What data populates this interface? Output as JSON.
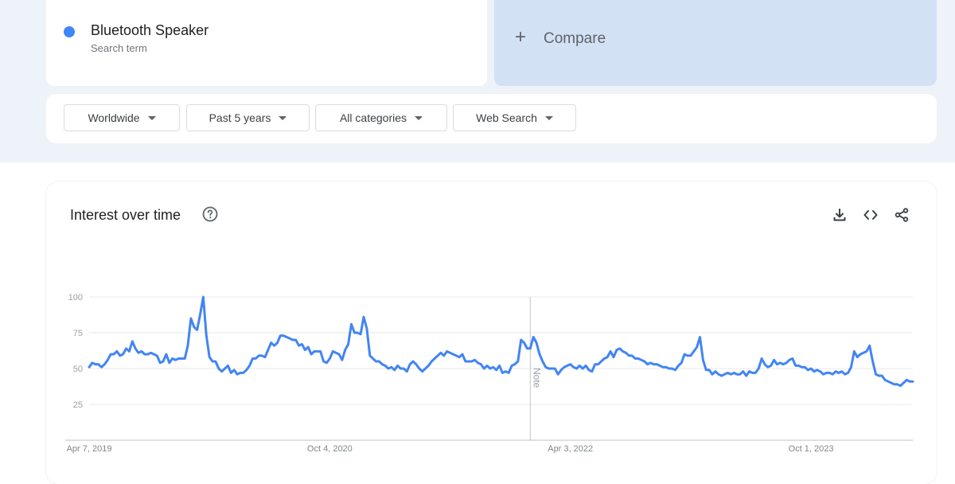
{
  "search_term": {
    "name": "Bluetooth Speaker",
    "subtitle": "Search term",
    "color": "#4285f4"
  },
  "compare": {
    "label": "Compare"
  },
  "filters": [
    {
      "label": "Worldwide"
    },
    {
      "label": "Past 5 years"
    },
    {
      "label": "All categories"
    },
    {
      "label": "Web Search"
    }
  ],
  "chart_panel": {
    "title": "Interest over time",
    "note_label": "Note"
  },
  "chart_data": {
    "type": "line",
    "title": "Interest over time",
    "ylim": [
      0,
      100
    ],
    "yticks": [
      25,
      50,
      75,
      100
    ],
    "grid": true,
    "x_tick_labels": [
      "Apr 7, 2019",
      "Oct 4, 2020",
      "Apr 3, 2022",
      "Oct 1, 2023"
    ],
    "x_tick_index": [
      0,
      78,
      156,
      234
    ],
    "note_index": 143,
    "series": [
      {
        "color": "#4285f4",
        "values": [
          51,
          54,
          53,
          53,
          51,
          53,
          56,
          60,
          60,
          62,
          59,
          60,
          64,
          62,
          69,
          64,
          61,
          62,
          60,
          60,
          61,
          60,
          59,
          54,
          55,
          60,
          54,
          57,
          56,
          57,
          57,
          57,
          66,
          85,
          79,
          77,
          88,
          100,
          73,
          58,
          55,
          55,
          50,
          48,
          50,
          52,
          47,
          49,
          46,
          47,
          47,
          49,
          52,
          57,
          57,
          59,
          59,
          58,
          63,
          68,
          66,
          68,
          73,
          73,
          72,
          71,
          70,
          70,
          66,
          67,
          63,
          65,
          60,
          62,
          62,
          62,
          55,
          54,
          57,
          62,
          61,
          60,
          56,
          63,
          67,
          81,
          75,
          75,
          74,
          86,
          78,
          59,
          57,
          55,
          55,
          53,
          52,
          50,
          51,
          49,
          52,
          50,
          50,
          48,
          53,
          55,
          53,
          50,
          48,
          50,
          52,
          55,
          57,
          59,
          61,
          59,
          62,
          61,
          60,
          59,
          58,
          60,
          55,
          55,
          55,
          56,
          54,
          53,
          50,
          52,
          50,
          51,
          49,
          52,
          47,
          48,
          47,
          52,
          53,
          55,
          70,
          68,
          64,
          64,
          72,
          68,
          60,
          55,
          51,
          50,
          50,
          50,
          46,
          49,
          51,
          52,
          53,
          51,
          50,
          52,
          50,
          52,
          49,
          48,
          53,
          53,
          55,
          57,
          58,
          62,
          58,
          63,
          64,
          62,
          61,
          59,
          59,
          57,
          57,
          56,
          55,
          53,
          54,
          53,
          53,
          52,
          51,
          51,
          50,
          50,
          49,
          52,
          54,
          60,
          59,
          59,
          62,
          65,
          72,
          56,
          49,
          49,
          46,
          48,
          46,
          45,
          46,
          47,
          46,
          47,
          46,
          46,
          48,
          45,
          48,
          47,
          47,
          50,
          57,
          53,
          51,
          52,
          56,
          53,
          54,
          53,
          54,
          56,
          57,
          52,
          52,
          51,
          51,
          49,
          50,
          48,
          49,
          48,
          46,
          47,
          47,
          46,
          48,
          47,
          48,
          46,
          47,
          51,
          62,
          58,
          60,
          61,
          62,
          66,
          55,
          46,
          45,
          45,
          42,
          41,
          40,
          39,
          39,
          38,
          40,
          42,
          41,
          41
        ]
      }
    ]
  },
  "colors": {
    "accent": "#4285f4",
    "compare_bg": "#d3e1f5",
    "band_bg": "#eef2f9"
  },
  "icons": {
    "term_dot": "blue-dot",
    "compare": "plus-icon",
    "filter_caret": "caret-down-icon",
    "help": "help-circle-icon",
    "download": "download-icon",
    "embed": "code-icon",
    "share": "share-icon"
  }
}
